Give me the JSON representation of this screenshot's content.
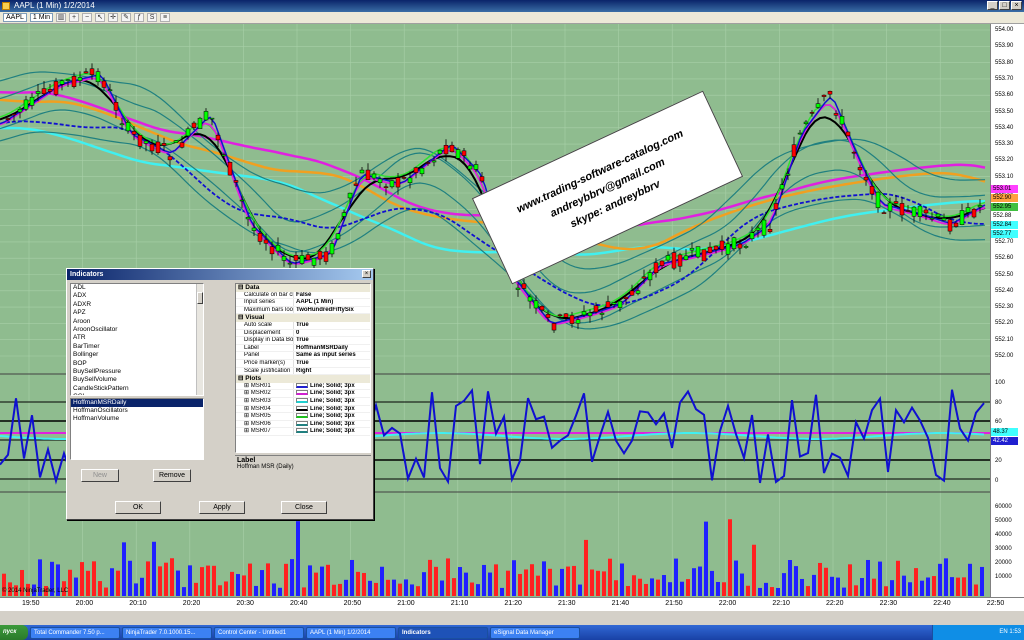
{
  "window": {
    "title": "AAPL (1 Min)  1/2/2014"
  },
  "toolbar": {
    "instrument": "AAPL",
    "interval": "1 Min"
  },
  "price_axis": [
    "554.00",
    "553.90",
    "553.80",
    "553.70",
    "553.60",
    "553.50",
    "553.40",
    "553.30",
    "553.20",
    "553.10",
    "553.00",
    "552.90",
    "552.80",
    "552.70",
    "552.60",
    "552.50",
    "552.40",
    "552.30",
    "552.20",
    "552.10",
    "552.00"
  ],
  "price_markers": [
    "553.01",
    "552.90",
    "552.95",
    "552.88",
    "552.84",
    "552.77"
  ],
  "osc_axis": [
    "100",
    "80",
    "60",
    "40",
    "20",
    "0"
  ],
  "osc_markers": [
    "48.37",
    "42.42"
  ],
  "vol_axis": [
    "60000",
    "50000",
    "40000",
    "30000",
    "20000",
    "10000"
  ],
  "time_axis": [
    "19:50",
    "20:00",
    "20:10",
    "20:20",
    "20:30",
    "20:40",
    "20:50",
    "21:00",
    "21:10",
    "21:20",
    "21:30",
    "21:40",
    "21:50",
    "22:00",
    "22:10",
    "22:20",
    "22:30",
    "22:40",
    "22:50"
  ],
  "copyright": "© 2014 NinjaTrader, LLC",
  "card": {
    "line1": "www.trading-software-catalog.com",
    "line2": "andreybbrv@gmail.com",
    "line3": "skype: andreybbrv"
  },
  "dialog": {
    "title": "Indicators",
    "indicators": [
      "ADL",
      "ADX",
      "ADXR",
      "APZ",
      "Aroon",
      "AroonOscillator",
      "ATR",
      "BarTimer",
      "Bollinger",
      "BOP",
      "BuySellPressure",
      "BuySellVolume",
      "CandleStickPattern",
      "CCI",
      "ChaikinMoneyFlow",
      "ChaikinOscillator"
    ],
    "configured": [
      "HoffmanMSRDaily",
      "HoffmanOscillators",
      "HoffmanVolume"
    ],
    "buttons": {
      "new": "New",
      "remove": "Remove",
      "ok": "OK",
      "apply": "Apply",
      "close": "Close"
    },
    "props": {
      "data_cat": "Data",
      "data": [
        {
          "name": "Calculate on bar close",
          "value": "False"
        },
        {
          "name": "Input series",
          "value": "AAPL (1 Min)"
        },
        {
          "name": "Maximum bars look ba",
          "value": "TwoHundredFiftySix"
        }
      ],
      "visual_cat": "Visual",
      "visual": [
        {
          "name": "Auto scale",
          "value": "True"
        },
        {
          "name": "Displacement",
          "value": "0"
        },
        {
          "name": "Display in Data Box",
          "value": "True"
        },
        {
          "name": "Label",
          "value": "HoffmanMSRDaily"
        },
        {
          "name": "Panel",
          "value": "Same as input series"
        },
        {
          "name": "Price marker(s)",
          "value": "True"
        },
        {
          "name": "Scale justification",
          "value": "Right"
        }
      ],
      "plots_cat": "Plots",
      "plots": [
        {
          "name": "MSR01",
          "value": "Line; Solid; 3px",
          "color": "#2020d0"
        },
        {
          "name": "MSR02",
          "value": "Line; Solid; 3px",
          "color": "#d020d0"
        },
        {
          "name": "MSR03",
          "value": "Line; Solid; 3px",
          "color": "#20d0d0"
        },
        {
          "name": "MSR04",
          "value": "Line; Solid; 3px",
          "color": "#000000"
        },
        {
          "name": "MSR05",
          "value": "Line; Solid; 3px",
          "color": "#20c020"
        },
        {
          "name": "MSR06",
          "value": "Line; Solid; 3px",
          "color": "#208080"
        },
        {
          "name": "MSR07",
          "value": "Line; Solid; 3px",
          "color": "#208080"
        }
      ]
    },
    "description": {
      "title": "Label",
      "text": "Hoffman MSR (Daily)"
    }
  },
  "taskbar": {
    "start": "пуск",
    "tasks": [
      "Total Commander 7.50 p...",
      "NinjaTrader 7.0.1000.15...",
      "Control Center - Untitled1",
      "AAPL (1 Min) 1/2/2014",
      "Indicators",
      "eSignal Data Manager"
    ],
    "active_index": 4,
    "tray": "EN  1:53"
  },
  "colors": {
    "chart_bg": "#8fbc8f",
    "up_candle": "#00ff00",
    "down_candle": "#ff0000",
    "magenta": "#e020e0",
    "orange": "#f0a020",
    "cyan": "#40f0f0",
    "blue": "#1010d0"
  }
}
